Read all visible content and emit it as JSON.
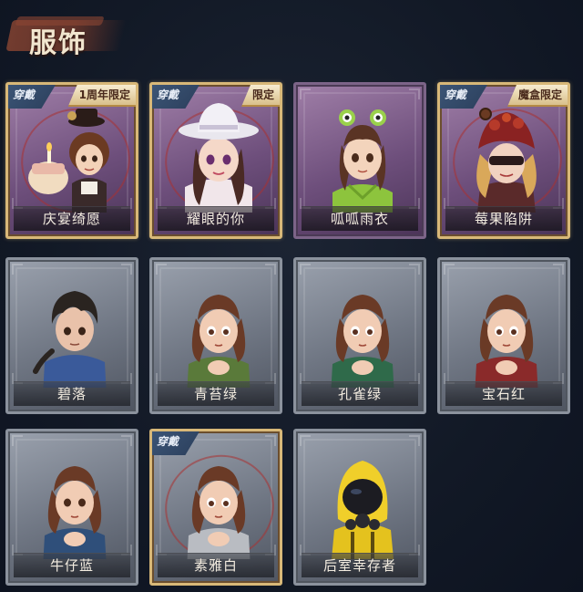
{
  "section": {
    "title": "服饰"
  },
  "outfits": [
    {
      "name": "庆宴绮愿",
      "worn_tag": "穿戴",
      "limit_tag": "1周年限定"
    },
    {
      "name": "耀眼的你",
      "worn_tag": "穿戴",
      "limit_tag": "限定"
    },
    {
      "name": "呱呱雨衣"
    },
    {
      "name": "莓果陷阱",
      "worn_tag": "穿戴",
      "limit_tag": "魔盒限定"
    },
    {
      "name": "碧落"
    },
    {
      "name": "青苔绿"
    },
    {
      "name": "孔雀绿"
    },
    {
      "name": "宝石红"
    },
    {
      "name": "牛仔蓝"
    },
    {
      "name": "素雅白",
      "worn_tag": "穿戴"
    },
    {
      "name": "后室幸存者"
    }
  ],
  "colors": {
    "premium_frame": "#a07fa8",
    "standard_frame": "#9aa1ad",
    "gold_border": "#d8b878",
    "worn_tag_bg": "#3c5576",
    "limit_tag_bg": "#f7ecd0",
    "page_bg": "#121926"
  }
}
